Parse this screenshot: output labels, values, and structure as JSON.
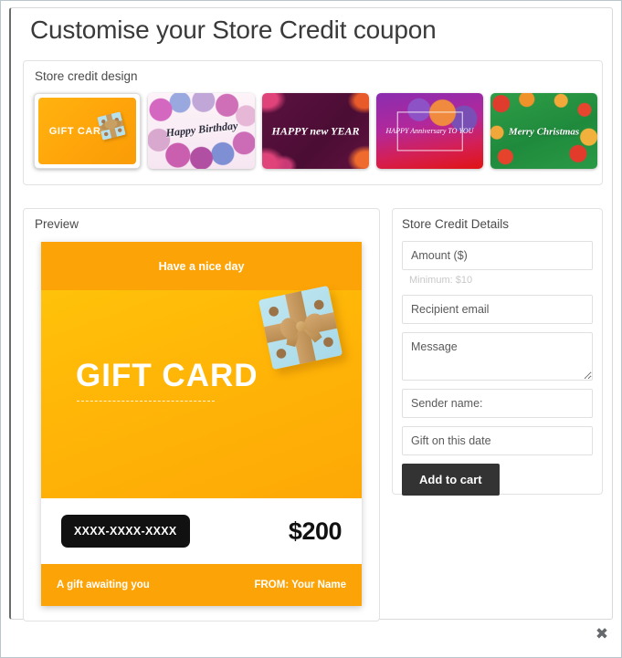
{
  "modal": {
    "title": "Customise your Store Credit coupon",
    "close_label": "✖"
  },
  "design_section": {
    "legend": "Store credit design",
    "thumbnails": [
      {
        "id": "gift-card",
        "label": "GIFT CARD",
        "selected": true,
        "icon": "gift-box-icon"
      },
      {
        "id": "birthday",
        "label": "Happy Birthday",
        "selected": false,
        "icon": "balloons-icon"
      },
      {
        "id": "new-year",
        "label": "HAPPY new YEAR",
        "selected": false,
        "icon": "leaves-icon"
      },
      {
        "id": "anniversary",
        "label": "HAPPY Anniversary TO YOU",
        "selected": false,
        "icon": "balloons-bunting-icon"
      },
      {
        "id": "christmas",
        "label": "Merry Christmas",
        "selected": false,
        "icon": "christmas-ornaments-icon"
      }
    ]
  },
  "preview_section": {
    "legend": "Preview",
    "card": {
      "header_text": "Have a nice day",
      "title": "GIFT CARD",
      "code": "XXXX-XXXX-XXXX",
      "amount": "$200",
      "footer_left": "A gift awaiting you",
      "footer_right": "FROM: Your Name",
      "artwork": "gift-box-icon"
    }
  },
  "details_section": {
    "legend": "Store Credit Details",
    "fields": [
      {
        "id": "amount",
        "placeholder": "Amount ($)",
        "value": "",
        "type": "text"
      },
      {
        "id": "recipient",
        "placeholder": "Recipient email",
        "value": "",
        "type": "text"
      },
      {
        "id": "message",
        "placeholder": "Message",
        "value": "",
        "type": "textarea"
      },
      {
        "id": "sender",
        "placeholder": "Sender name:",
        "value": "",
        "type": "text"
      },
      {
        "id": "date",
        "placeholder": "Gift on this date",
        "value": "",
        "type": "text"
      }
    ],
    "amount_hint": "Minimum: $10",
    "submit_label": "Add to cart"
  },
  "colors": {
    "card_orange": "#fca307",
    "card_body_gold": "#ffb607",
    "button_dark": "#333333",
    "code_black": "#111111"
  }
}
